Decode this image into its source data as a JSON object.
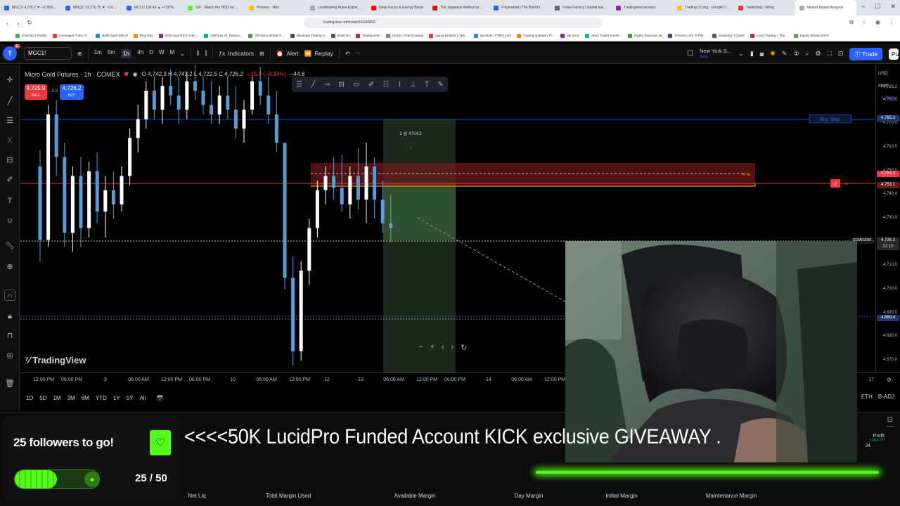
{
  "browser": {
    "tabs": [
      {
        "title": "MGC1! 4,726.2 ▼ −0.36% …",
        "color": "#2962ff",
        "active": false
      },
      {
        "title": "MNQ1! 23,270.75 ▼ −0.08%",
        "color": "#2962ff",
        "active": false
      },
      {
        "title": "MCL1! 105.42 ▲ +7.87%",
        "color": "#2962ff",
        "active": false
      },
      {
        "title": "G/F · Watch the HOD on Kick",
        "color": "#53fc18",
        "active": false
      },
      {
        "title": "Process · Miro",
        "color": "#f7c600",
        "active": false
      },
      {
        "title": "Lucidtrading Rules Explained",
        "color": "#aaaaaa",
        "active": false
      },
      {
        "title": "Deep Focus & Energy Boost",
        "color": "#ff0000",
        "active": false
      },
      {
        "title": "The Japanese Method to Effort",
        "color": "#ff0000",
        "active": false
      },
      {
        "title": "Polymarket | The World's Largest",
        "color": "#2962ff",
        "active": false
      },
      {
        "title": "Forex Factory | Global markets",
        "color": "#666666",
        "active": false
      },
      {
        "title": "Tradingview session",
        "color": "#8e24aa",
        "active": false
      },
      {
        "title": "Trading v2.png · Google Drive",
        "color": "#f7c600",
        "active": false
      },
      {
        "title": "TradeStop | Whop",
        "color": "#f23645",
        "active": false
      },
      {
        "title": "Market Impact Analysis",
        "color": "#aaaaaa",
        "active": true
      }
    ],
    "url": "tradingview.com/chart/3XGKM6Z/",
    "bookmarks": [
      "Chat Bot | Firefox",
      "Leveraged Turbo Tr…",
      "Build Apps with AI",
      "Blue Ray",
      "2026 Audi RS 6 Avan…",
      "USForex #1 Tastyco…",
      "Dll Demo Mobile F…",
      "Hivemind Trading AI",
      "limits hm",
      "Tradeproven",
      "Home | ChartChamps",
      "Liquid Brokers | Ope…",
      "Symbols | FTMO.com",
      "Trading updates | Fl…",
      "My Duos",
      "Apex Trader Funde…",
      "Elgato Facecam 4K",
      "Amazon.com: FIFIN…",
      "ScaleAlgo | Quant",
      "Lucid Trading – The…",
      "Elgato Stream Deck"
    ]
  },
  "toolbar": {
    "logo_badge": "11",
    "symbol": "MGC1!",
    "intervals": [
      "1m",
      "5m",
      "1h",
      "4h",
      "D",
      "W",
      "M"
    ],
    "selected_interval": "1h",
    "indicators_label": "Indicators",
    "alert_label": "Alert",
    "replay_label": "Replay",
    "session_label": "New York S…",
    "session_sub": "Save",
    "trade_label": "Trade",
    "publish_label": "Pu"
  },
  "chart": {
    "title": "Micro Gold Futures · 1h · COMEX",
    "ohlc": "O 4,742.3  H 4,743.2  L 4,722.5  C 4,726.2",
    "change": "−15.9 (−0.34%)",
    "volume": "−44.8",
    "sell_price": "4,725.9",
    "sell_label": "SELL",
    "buy_price": "4,726.2",
    "buy_label": "BUY",
    "spread": "0.3",
    "trade_marker": "2 @ 4754.3",
    "zone_label": "4 hr",
    "buy_stop_label": "Buy Stop",
    "position_qty": "-2",
    "watermark": "TradingView",
    "price_ticks": [
      "4,785.2",
      "4,780.0",
      "4,770.0",
      "4,760.0",
      "4,750.0",
      "4,740.0",
      "4,730.0",
      "4,710.0",
      "4,700.0",
      "4,690.0",
      "4,680.0",
      "4,670.0"
    ],
    "price_labels": {
      "top1": "4,789.4",
      "buy_stop": "4,785.3",
      "red": "4,754.3",
      "red2": "4,753.1",
      "last": "4,726.2",
      "countdown": "32:10",
      "blue_low": "4,689.4",
      "symbol_tag": "GCMD2026"
    },
    "time_ticks": [
      "12:00 PM",
      "06:00 PM",
      "9",
      "06:00 AM",
      "12:00 PM",
      "06:00 PM",
      "10",
      "06:00 AM",
      "12:00 PM",
      "12",
      "13",
      "06:00 AM",
      "12:00 PM",
      "06:00 PM",
      "14",
      "06:00 AM",
      "12:00 PM",
      "17"
    ],
    "ranges": [
      "1D",
      "5D",
      "1M",
      "3M",
      "6M",
      "YTD",
      "1Y",
      "5Y",
      "All"
    ],
    "range_right": [
      "ETH",
      "B-ADJ"
    ],
    "axis_unit": "USD",
    "axis_scale": "apoc"
  },
  "chart_data": {
    "type": "candlestick",
    "ylim": [
      4665,
      4795
    ],
    "candles": [
      [
        4752,
        4759,
        4712,
        4721
      ],
      [
        4721,
        4778,
        4718,
        4774
      ],
      [
        4774,
        4780,
        4748,
        4756
      ],
      [
        4756,
        4762,
        4718,
        4724
      ],
      [
        4724,
        4752,
        4716,
        4748
      ],
      [
        4748,
        4756,
        4718,
        4726
      ],
      [
        4726,
        4754,
        4722,
        4750
      ],
      [
        4750,
        4758,
        4728,
        4733
      ],
      [
        4733,
        4748,
        4722,
        4742
      ],
      [
        4742,
        4750,
        4730,
        4736
      ],
      [
        4736,
        4752,
        4733,
        4748
      ],
      [
        4748,
        4768,
        4744,
        4764
      ],
      [
        4764,
        4778,
        4758,
        4772
      ],
      [
        4772,
        4788,
        4768,
        4784
      ],
      [
        4784,
        4790,
        4772,
        4776
      ],
      [
        4776,
        4790,
        4770,
        4786
      ],
      [
        4786,
        4793,
        4778,
        4782
      ],
      [
        4782,
        4790,
        4770,
        4776
      ],
      [
        4776,
        4792,
        4772,
        4788
      ],
      [
        4788,
        4795,
        4780,
        4784
      ],
      [
        4784,
        4790,
        4774,
        4778
      ],
      [
        4778,
        4788,
        4770,
        4774
      ],
      [
        4774,
        4786,
        4770,
        4782
      ],
      [
        4782,
        4790,
        4772,
        4776
      ],
      [
        4776,
        4786,
        4764,
        4768
      ],
      [
        4768,
        4780,
        4762,
        4776
      ],
      [
        4776,
        4790,
        4774,
        4788
      ],
      [
        4788,
        4794,
        4778,
        4782
      ],
      [
        4782,
        4790,
        4770,
        4774
      ],
      [
        4774,
        4784,
        4758,
        4762
      ],
      [
        4762,
        4754,
        4700,
        4705
      ],
      [
        4705,
        4714,
        4668,
        4674
      ],
      [
        4674,
        4712,
        4670,
        4708
      ],
      [
        4708,
        4730,
        4702,
        4726
      ],
      [
        4726,
        4746,
        4722,
        4742
      ],
      [
        4742,
        4752,
        4736,
        4748
      ],
      [
        4748,
        4756,
        4738,
        4743
      ],
      [
        4743,
        4757,
        4733,
        4736
      ],
      [
        4736,
        4752,
        4730,
        4748
      ],
      [
        4748,
        4760,
        4734,
        4738
      ],
      [
        4738,
        4762,
        4728,
        4752
      ],
      [
        4752,
        4756,
        4730,
        4738
      ],
      [
        4738,
        4746,
        4724,
        4728
      ],
      [
        4728,
        4740,
        4720,
        4726
      ]
    ]
  },
  "overlay": {
    "followers_text": "25 followers to go!",
    "progress": 0.5,
    "progress_label": "25 / 50",
    "banner": "<<<<50K LucidPro Funded Account KICK exclusive GIVEAWAY ."
  },
  "account": {
    "columns": [
      "Net Liq",
      "Total Margin Used",
      "Available Margin",
      "Day Margin",
      "Initial Margin",
      "Maintenance Margin"
    ],
    "profit_label": "Profit",
    "profit_value": "+494.00",
    "left_value": "34"
  }
}
